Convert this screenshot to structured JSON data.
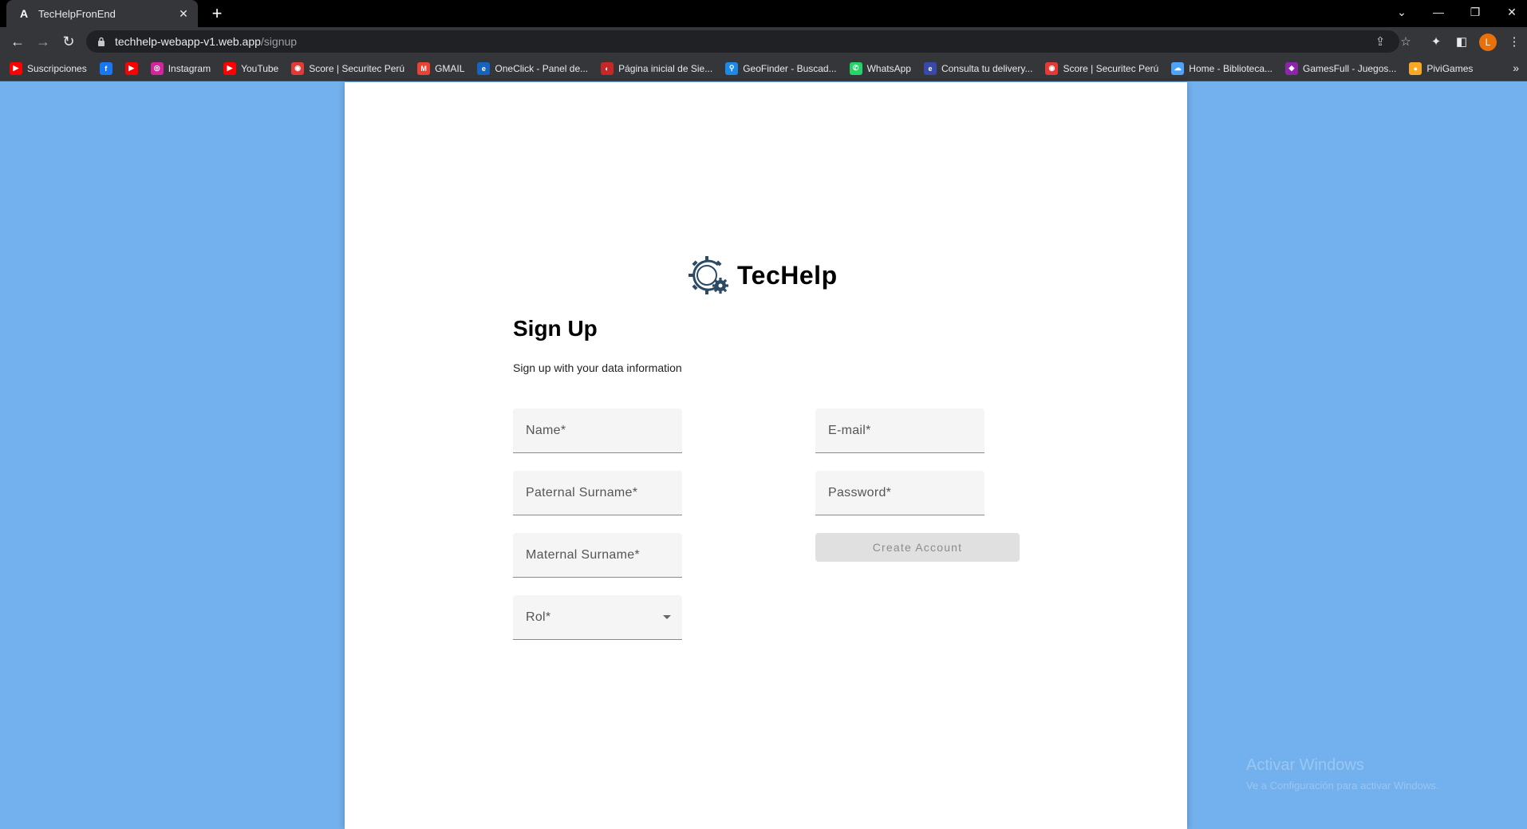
{
  "browser": {
    "tab_title": "TecHelpFronEnd",
    "tab_favicon": "A",
    "new_tab_symbol": "+",
    "url_host": "techhelp-webapp-v1.web.app",
    "url_path": "/signup",
    "profile_initial": "L",
    "bookmarks": [
      {
        "label": "Suscripciones",
        "icon": "youtube-icon",
        "color": "#ff0000",
        "glyph": "▶"
      },
      {
        "label": "",
        "icon": "facebook-icon",
        "color": "#1877f2",
        "glyph": "f"
      },
      {
        "label": "",
        "icon": "youtube-icon",
        "color": "#ff0000",
        "glyph": "▶"
      },
      {
        "label": "Instagram",
        "icon": "instagram-icon",
        "color": "#d6249f",
        "glyph": "◎"
      },
      {
        "label": "YouTube",
        "icon": "youtube-icon",
        "color": "#ff0000",
        "glyph": "▶"
      },
      {
        "label": "Score | Securitec Perú",
        "icon": "score-icon",
        "color": "#e53935",
        "glyph": "◉"
      },
      {
        "label": "GMAIL",
        "icon": "gmail-icon",
        "color": "#ea4335",
        "glyph": "M"
      },
      {
        "label": "OneClick - Panel de...",
        "icon": "oneclick-icon",
        "color": "#1565c0",
        "glyph": "e"
      },
      {
        "label": "Página inicial de Sie...",
        "icon": "siebel-icon",
        "color": "#c62828",
        "glyph": "◐"
      },
      {
        "label": "GeoFinder - Buscad...",
        "icon": "location-pin-icon",
        "color": "#1e88e5",
        "glyph": "⚲"
      },
      {
        "label": "WhatsApp",
        "icon": "whatsapp-icon",
        "color": "#25d366",
        "glyph": "✆"
      },
      {
        "label": "Consulta tu delivery...",
        "icon": "delivery-icon",
        "color": "#3949ab",
        "glyph": "e"
      },
      {
        "label": "Score | Securitec Perú",
        "icon": "score-icon",
        "color": "#e53935",
        "glyph": "◉"
      },
      {
        "label": "Home - Biblioteca...",
        "icon": "cloud-icon",
        "color": "#4fa3f7",
        "glyph": "☁"
      },
      {
        "label": "GamesFull - Juegos...",
        "icon": "gamepad-icon",
        "color": "#8e24aa",
        "glyph": "◆"
      },
      {
        "label": "PiviGames",
        "icon": "pivigames-icon",
        "color": "#f9a825",
        "glyph": "●"
      }
    ],
    "more_bookmarks": "»"
  },
  "page": {
    "background_color": "#72b1ee",
    "brand_name": "TecHelp",
    "brand_color": "#2c4a63",
    "title": "Sign Up",
    "subtitle": "Sign up with your data information",
    "fields": {
      "name": "Name*",
      "paternal_surname": "Paternal Surname*",
      "maternal_surname": "Maternal Surname*",
      "rol": "Rol*",
      "email": "E-mail*",
      "password": "Password*"
    },
    "create_button": "Create Account"
  },
  "watermark": {
    "line1": "Activar Windows",
    "line2": "Ve a Configuración para activar Windows."
  }
}
